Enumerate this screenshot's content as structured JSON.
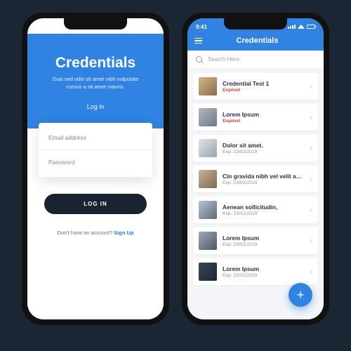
{
  "status": {
    "time": "9:41"
  },
  "login": {
    "title": "Credentials",
    "subtitle": "Duis sed odio sit amet nibh vulputate cursus a sit amet mauris.",
    "tab": "Log in",
    "email_placeholder": "Email address",
    "password_placeholder": "Password",
    "button": "LOG IN",
    "no_account": "Don't have an account? ",
    "signup": "Sign Up"
  },
  "list": {
    "header": "Credentials",
    "search_placeholder": "Search Here",
    "items": [
      {
        "title": "Credential Test 1",
        "sub": "Expired",
        "status": "expired"
      },
      {
        "title": "Lorem Ipsum",
        "sub": "Expired",
        "status": "expired"
      },
      {
        "title": "Dolor sit amet.",
        "sub": "Exp. 23/02/2019",
        "status": "ok"
      },
      {
        "title": "Cin gravida nibh vel velit auctor",
        "sub": "Exp. 23/02/2019",
        "status": "ok"
      },
      {
        "title": "Aenean sollicitudin,",
        "sub": "Exp. 23/02/2019",
        "status": "ok"
      },
      {
        "title": "Lorem Ipsum",
        "sub": "Exp. 23/02/2019",
        "status": "ok"
      },
      {
        "title": "Lorem Ipsum",
        "sub": "Exp. 23/02/2019",
        "status": "ok"
      }
    ]
  }
}
